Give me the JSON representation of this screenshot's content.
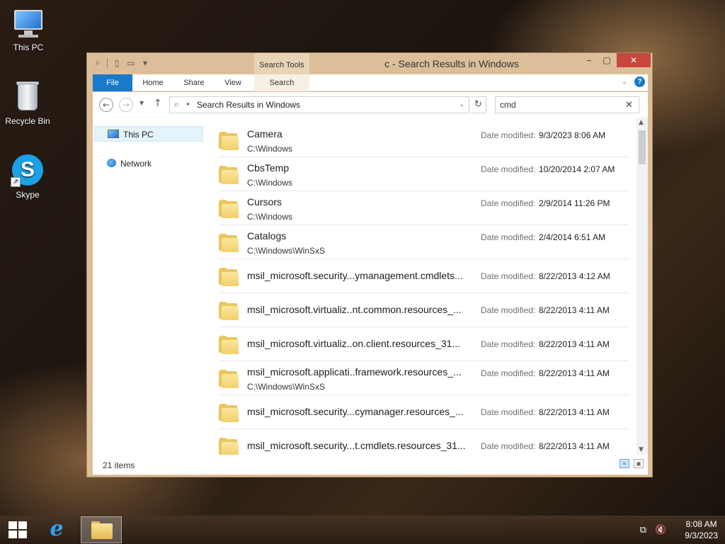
{
  "desktop": {
    "icons": [
      {
        "label": "This PC"
      },
      {
        "label": "Recycle Bin"
      },
      {
        "label": "Skype"
      }
    ]
  },
  "window": {
    "title": "c - Search Results in Windows",
    "contextual_tab_group": "Search Tools",
    "ribbon_tabs": [
      "File",
      "Home",
      "Share",
      "View",
      "Search"
    ],
    "address": "Search Results in Windows",
    "search_value": "cmd",
    "nav_pane": [
      "This PC",
      "Network"
    ],
    "date_label": "Date modified:",
    "results": [
      {
        "name": "Camera",
        "path": "C:\\Windows",
        "date": "9/3/2023 8:06 AM"
      },
      {
        "name": "CbsTemp",
        "path": "C:\\Windows",
        "date": "10/20/2014 2:07 AM"
      },
      {
        "name": "Cursors",
        "path": "C:\\Windows",
        "date": "2/9/2014 11:26 PM"
      },
      {
        "name": "Catalogs",
        "path": "C:\\Windows\\WinSxS",
        "date": "2/4/2014 6:51 AM"
      },
      {
        "name": "msil_microsoft.security...ymanagement.cmdlets...",
        "path": "",
        "date": "8/22/2013 4:12 AM"
      },
      {
        "name": "msil_microsoft.virtualiz..nt.common.resources_...",
        "path": "",
        "date": "8/22/2013 4:11 AM"
      },
      {
        "name": "msil_microsoft.virtualiz..on.client.resources_31...",
        "path": "",
        "date": "8/22/2013 4:11 AM"
      },
      {
        "name": "msil_microsoft.applicati..framework.resources_...",
        "path": "C:\\Windows\\WinSxS",
        "date": "8/22/2013 4:11 AM"
      },
      {
        "name": "msil_microsoft.security...cymanager.resources_...",
        "path": "",
        "date": "8/22/2013 4:11 AM"
      },
      {
        "name": "msil_microsoft.security...t.cmdlets.resources_31...",
        "path": "",
        "date": "8/22/2013 4:11 AM"
      }
    ],
    "status": "21 items"
  },
  "taskbar": {
    "time": "8:08 AM",
    "date": "9/3/2023"
  },
  "icons": {
    "back": "back-arrow-icon",
    "forward": "forward-arrow-icon",
    "up": "up-arrow-icon",
    "refresh": "refresh-icon",
    "clear": "close-icon",
    "help": "help-icon"
  },
  "colors": {
    "accent": "#1979ca",
    "close_button": "#c7463e",
    "window_frame": "#dcbf9a",
    "highlight": "#f5d36a"
  }
}
